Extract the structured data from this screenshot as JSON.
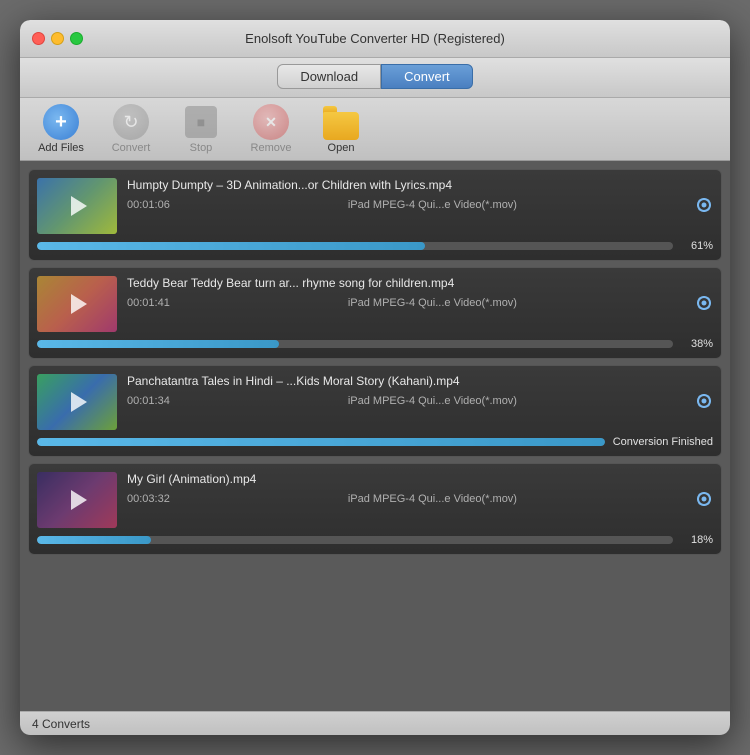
{
  "window": {
    "title": "Enolsoft YouTube Converter HD (Registered)"
  },
  "mode_tabs": {
    "download": "Download",
    "convert": "Convert",
    "active": "convert"
  },
  "toolbar": {
    "add_files": "Add Files",
    "convert": "Convert",
    "stop": "Stop",
    "remove": "Remove",
    "open": "Open"
  },
  "videos": [
    {
      "id": 1,
      "title": "Humpty Dumpty – 3D Animation...or Children with Lyrics.mp4",
      "duration": "00:01:06",
      "format": "iPad MPEG-4 Qui...e Video(*.mov)",
      "progress": 61,
      "progress_label": "61%",
      "finished": false,
      "thumb_class": "thumb-1"
    },
    {
      "id": 2,
      "title": "Teddy Bear Teddy Bear turn ar... rhyme song for children.mp4",
      "duration": "00:01:41",
      "format": "iPad MPEG-4 Qui...e Video(*.mov)",
      "progress": 38,
      "progress_label": "38%",
      "finished": false,
      "thumb_class": "thumb-2"
    },
    {
      "id": 3,
      "title": "Panchatantra Tales in Hindi – ...Kids Moral Story (Kahani).mp4",
      "duration": "00:01:34",
      "format": "iPad MPEG-4 Qui...e Video(*.mov)",
      "progress": 100,
      "progress_label": "",
      "finished": true,
      "finished_label": "Conversion Finished",
      "thumb_class": "thumb-3"
    },
    {
      "id": 4,
      "title": "My Girl (Animation).mp4",
      "duration": "00:03:32",
      "format": "iPad MPEG-4 Qui...e Video(*.mov)",
      "progress": 18,
      "progress_label": "18%",
      "finished": false,
      "thumb_class": "thumb-4"
    }
  ],
  "status": {
    "text": "4 Converts"
  }
}
